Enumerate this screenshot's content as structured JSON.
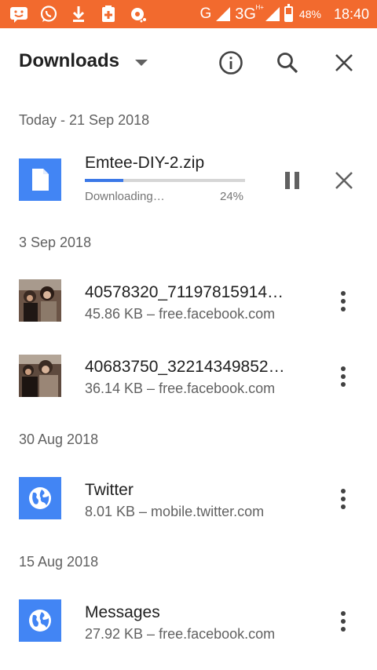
{
  "status_bar": {
    "network_type": "G",
    "network_type_2": "3G",
    "network_sup": "H+",
    "battery_percent": "48%",
    "battery_level": 0.48,
    "time": "18:40",
    "accent_color": "#f26a2e"
  },
  "header": {
    "title": "Downloads"
  },
  "sections": {
    "today": "Today - 21 Sep 2018",
    "sep3": "3 Sep 2018",
    "aug30": "30 Aug 2018",
    "aug15": "15 Aug 2018"
  },
  "active_download": {
    "name": "Emtee-DIY-2.zip",
    "status": "Downloading…",
    "percent_label": "24%",
    "progress": 0.24
  },
  "items": [
    {
      "name": "40578320_71197815914…",
      "meta": "45.86 KB – free.facebook.com"
    },
    {
      "name": "40683750_32214349852…",
      "meta": "36.14 KB – free.facebook.com"
    },
    {
      "name": "Twitter",
      "meta": "8.01 KB – mobile.twitter.com"
    },
    {
      "name": "Messages",
      "meta": "27.92 KB – free.facebook.com"
    }
  ],
  "colors": {
    "icon_blue": "#4285f4",
    "progress_blue": "#3b78e7"
  }
}
